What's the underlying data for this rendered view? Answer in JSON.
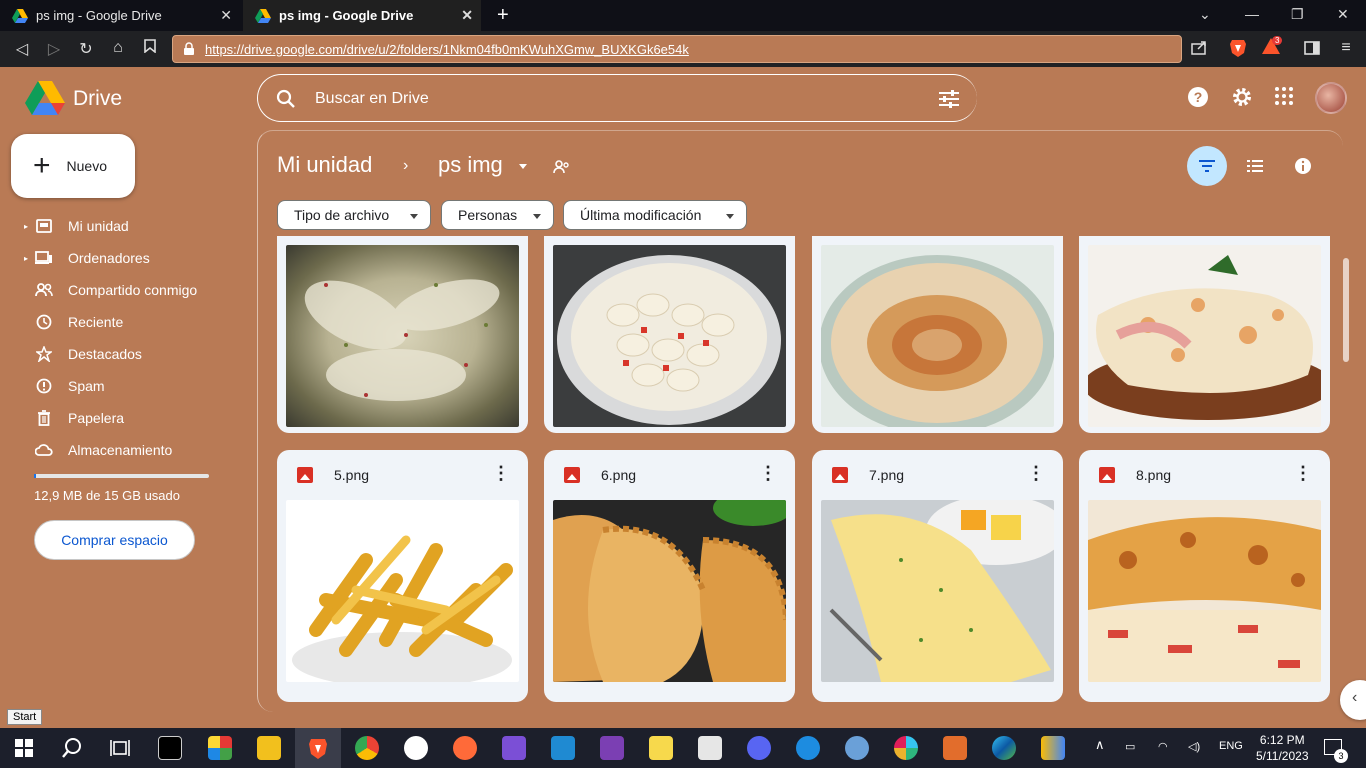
{
  "browser": {
    "tabs": [
      {
        "title": "ps img - Google Drive",
        "active": false
      },
      {
        "title": "ps img - Google Drive",
        "active": true
      }
    ],
    "url": "https://drive.google.com/drive/u/2/folders/1Nkm04fb0mKWuhXGmw_BUXKGk6e54k",
    "shield_badge": "3"
  },
  "app": {
    "name": "Drive",
    "search_placeholder": "Buscar en Drive"
  },
  "sidebar": {
    "new_label": "Nuevo",
    "items": [
      {
        "label": "Mi unidad",
        "icon": "drive-icon",
        "expandable": true
      },
      {
        "label": "Ordenadores",
        "icon": "computer-icon",
        "expandable": true
      },
      {
        "label": "Compartido conmigo",
        "icon": "people-icon",
        "expandable": false
      },
      {
        "label": "Reciente",
        "icon": "clock-icon",
        "expandable": false
      },
      {
        "label": "Destacados",
        "icon": "star-icon",
        "expandable": false
      },
      {
        "label": "Spam",
        "icon": "spam-icon",
        "expandable": false
      },
      {
        "label": "Papelera",
        "icon": "trash-icon",
        "expandable": false
      },
      {
        "label": "Almacenamiento",
        "icon": "cloud-icon",
        "expandable": false
      }
    ],
    "storage_text": "12,9 MB de 15 GB usado",
    "storage_fraction": 0.01,
    "buy_label": "Comprar espacio"
  },
  "breadcrumb": {
    "root": "Mi unidad",
    "current": "ps img"
  },
  "filters": [
    "Tipo de archivo",
    "Personas",
    "Última modificación"
  ],
  "files": [
    {
      "name": "",
      "kind": "chicken"
    },
    {
      "name": "",
      "kind": "beans"
    },
    {
      "name": "",
      "kind": "hummus"
    },
    {
      "name": "",
      "kind": "pizza-milanesa"
    },
    {
      "name": "5.png",
      "kind": "fries"
    },
    {
      "name": "6.png",
      "kind": "empanadas"
    },
    {
      "name": "7.png",
      "kind": "omelette"
    },
    {
      "name": "8.png",
      "kind": "lasagna"
    }
  ],
  "taskbar": {
    "start_tooltip": "Start",
    "language": "ENG",
    "time": "6:12 PM",
    "date": "5/11/2023",
    "notifications": "3"
  },
  "colors": {
    "theme_background": "#b97a55",
    "accent": "#0b57d0",
    "card_background": "#f0f4f9"
  }
}
